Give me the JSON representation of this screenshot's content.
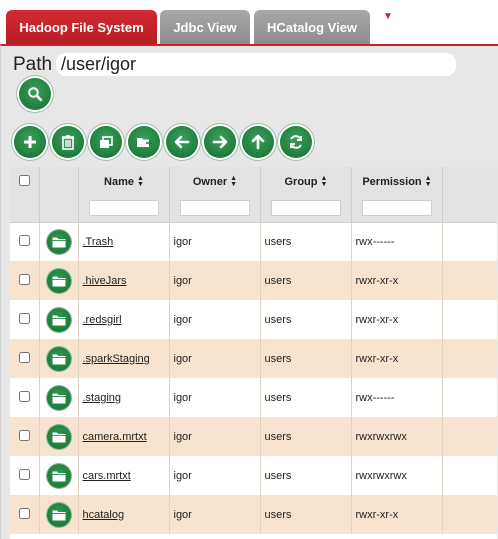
{
  "tabs": [
    {
      "label": "Hadoop File System",
      "active": true
    },
    {
      "label": "Jdbc View",
      "active": false
    },
    {
      "label": "HCatalog View",
      "active": false
    }
  ],
  "tab_menu_icon": "caret-down-icon",
  "path": {
    "label": "Path",
    "value": "/user/igor"
  },
  "toolbar": {
    "icons": [
      "add-icon",
      "delete-icon",
      "copy-icon",
      "move-icon",
      "back-icon",
      "forward-icon",
      "up-icon",
      "refresh-icon"
    ]
  },
  "table": {
    "columns": [
      "Name",
      "Owner",
      "Group",
      "Permission"
    ],
    "rows": [
      {
        "name": ".Trash",
        "owner": "igor",
        "group": "users",
        "permission": "rwx------"
      },
      {
        "name": ".hiveJars",
        "owner": "igor",
        "group": "users",
        "permission": "rwxr-xr-x"
      },
      {
        "name": ".redsgirl",
        "owner": "igor",
        "group": "users",
        "permission": "rwxr-xr-x"
      },
      {
        "name": ".sparkStaging",
        "owner": "igor",
        "group": "users",
        "permission": "rwxr-xr-x"
      },
      {
        "name": ".staging",
        "owner": "igor",
        "group": "users",
        "permission": "rwx------"
      },
      {
        "name": "camera.mrtxt",
        "owner": "igor",
        "group": "users",
        "permission": "rwxrwxrwx"
      },
      {
        "name": "cars.mrtxt",
        "owner": "igor",
        "group": "users",
        "permission": "rwxrwxrwx"
      },
      {
        "name": "hcatalog",
        "owner": "igor",
        "group": "users",
        "permission": "rwxr-xr-x"
      }
    ]
  },
  "colors": {
    "accent": "#c8242b",
    "button_green": "#1f7d3c",
    "row_alt": "#f7e4d0"
  }
}
